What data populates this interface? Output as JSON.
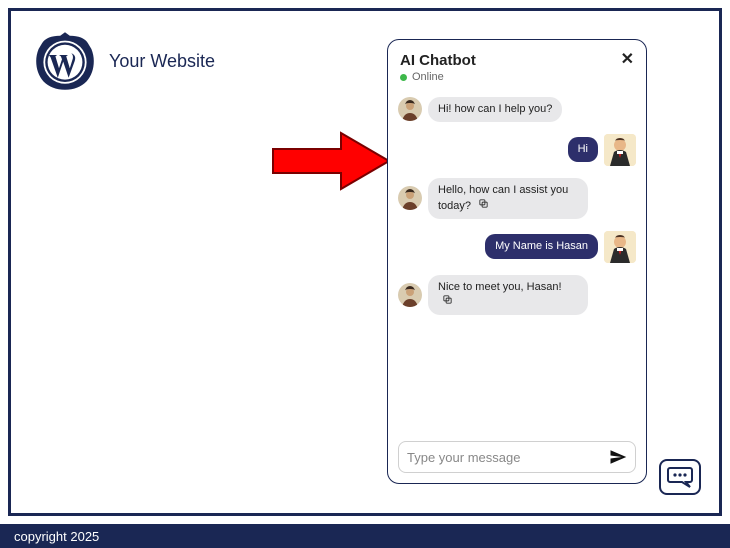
{
  "header": {
    "site_title": "Your Website"
  },
  "chatbot": {
    "title": "AI Chatbot",
    "status": "Online",
    "messages": [
      {
        "role": "bot",
        "text": "Hi! how can I help you?",
        "copyable": false
      },
      {
        "role": "user",
        "text": "Hi",
        "copyable": false
      },
      {
        "role": "bot",
        "text": "Hello, how can I assist you today?",
        "copyable": true
      },
      {
        "role": "user",
        "text": "My Name is Hasan",
        "copyable": false
      },
      {
        "role": "bot",
        "text": "Nice to meet you, Hasan!",
        "copyable": true
      }
    ],
    "input_placeholder": "Type your message"
  },
  "footer": {
    "copyright": "copyright 2025"
  }
}
